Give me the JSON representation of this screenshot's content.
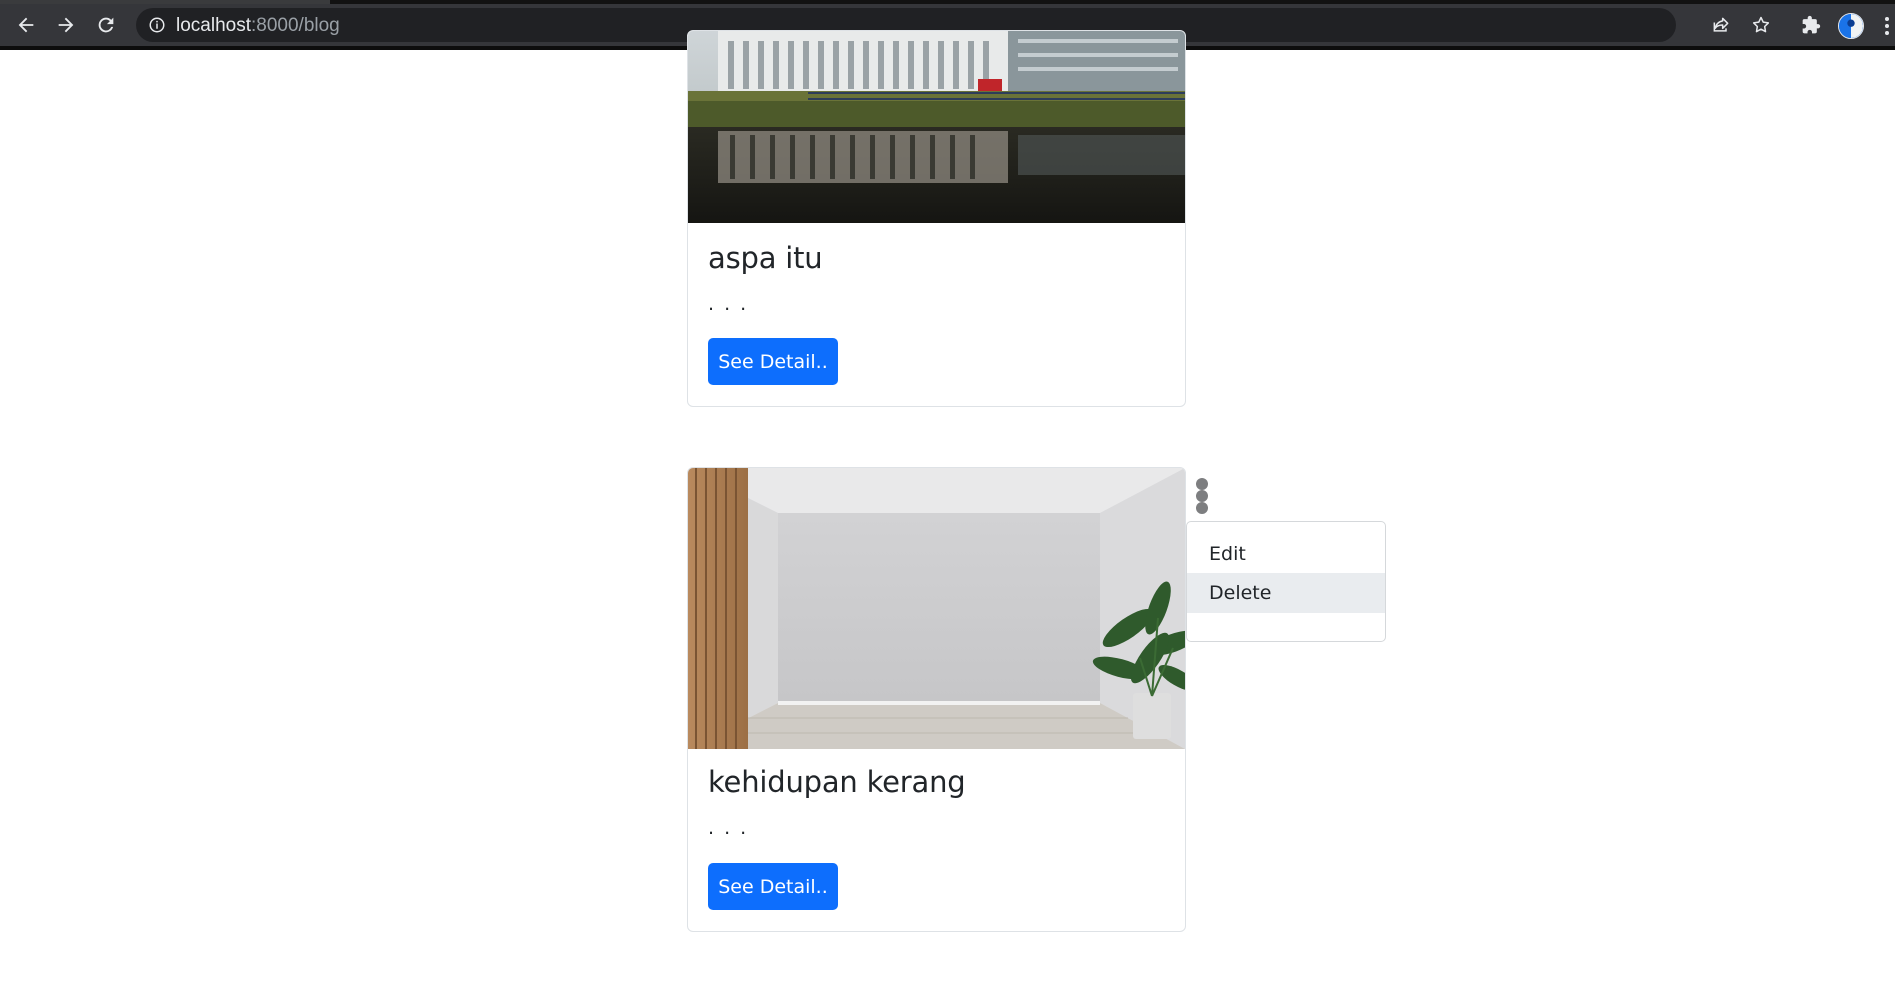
{
  "browser": {
    "url_host": "localhost",
    "url_rest": ":8000/blog"
  },
  "posts": [
    {
      "title": "aspa itu",
      "excerpt": ". . .",
      "button_label": "See Detail.."
    },
    {
      "title": "kehidupan kerang",
      "excerpt": ". . .",
      "button_label": "See Detail.."
    }
  ],
  "dropdown": {
    "items": [
      {
        "label": "Edit"
      },
      {
        "label": "Delete",
        "highlighted": true
      }
    ]
  },
  "colors": {
    "primary_button": "#0d6efd",
    "dropdown_hover": "#e9ecef",
    "browser_toolbar": "#35363a"
  }
}
